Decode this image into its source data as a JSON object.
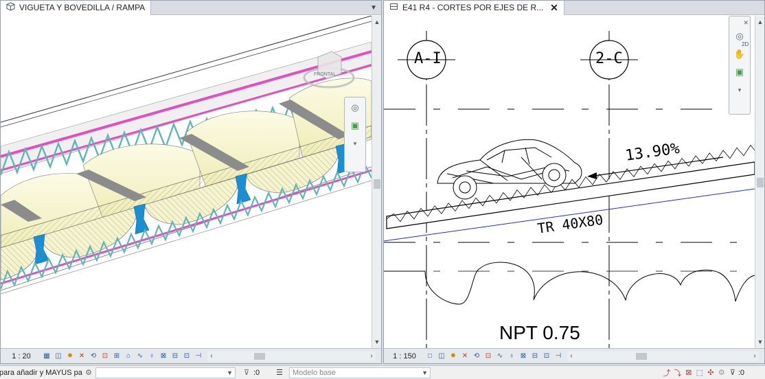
{
  "left_view": {
    "tab_title": "VIGUETA Y BOVEDILLA / RAMPA",
    "view_icon": "3d-cube-icon",
    "scale": "1 : 20",
    "viewcube_label": "FRONTAL"
  },
  "right_view": {
    "tab_title": "E41 R4 - CORTES POR EJES DE R...",
    "view_icon": "section-view-icon",
    "scale": "1 : 150",
    "grid_bubbles": [
      "A-I",
      "2-C"
    ],
    "slope_label": "13.90%",
    "beam_label": "TR 40X80",
    "level_label": "NPT 0.75",
    "nav_2d_label": "2D"
  },
  "status_bar": {
    "hint_text": "para añadir y MAYÚS pa",
    "filter_count_1": ":0",
    "workset": "Modelo base",
    "filter_count_2": ":0"
  },
  "colors": {
    "slab_pink": "#e24fc0",
    "rebar_teal": "#5fb6b6",
    "block_cream": "#f8f6cf",
    "joist_blue": "#1a8fd4",
    "ref_line_blue": "#2030c8"
  }
}
